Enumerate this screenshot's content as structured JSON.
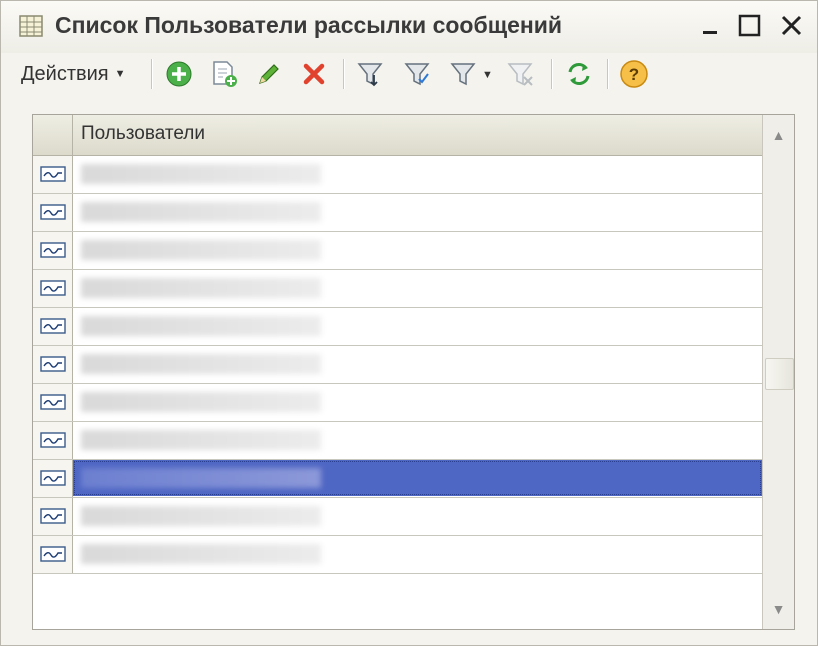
{
  "window": {
    "title": "Список Пользователи рассылки сообщений",
    "controls": {
      "minimize": "_",
      "maximize": "☐",
      "close": "✕"
    }
  },
  "toolbar": {
    "actions_label": "Действия",
    "buttons": [
      {
        "name": "add-icon",
        "color": "#3aa33a"
      },
      {
        "name": "copy-add-icon",
        "color": "#7c8a99"
      },
      {
        "name": "edit-pencil-icon",
        "color": "#4b9b2b"
      },
      {
        "name": "delete-x-icon",
        "color": "#d93a2a"
      },
      {
        "name": "filter-set-icon",
        "color": "#7a8794"
      },
      {
        "name": "filter-by-value-icon",
        "color": "#7a8794"
      },
      {
        "name": "filter-history-icon",
        "color": "#7a8794"
      },
      {
        "name": "filter-clear-icon",
        "color": "#b5b9bd"
      },
      {
        "name": "refresh-icon",
        "color": "#2f9a3a"
      },
      {
        "name": "help-icon",
        "color": "#e7a62c"
      }
    ]
  },
  "table": {
    "column_header": "Пользователи",
    "rows": [
      {
        "value": "",
        "selected": false
      },
      {
        "value": "",
        "selected": false
      },
      {
        "value": "",
        "selected": false
      },
      {
        "value": "",
        "selected": false
      },
      {
        "value": "",
        "selected": false
      },
      {
        "value": "",
        "selected": false
      },
      {
        "value": "",
        "selected": false
      },
      {
        "value": "",
        "selected": false
      },
      {
        "value": "",
        "selected": true
      },
      {
        "value": "",
        "selected": false
      },
      {
        "value": "",
        "selected": false
      }
    ],
    "selection_color": "#4f67c4"
  },
  "scrollbar": {
    "up": "▲",
    "down": "▼"
  }
}
